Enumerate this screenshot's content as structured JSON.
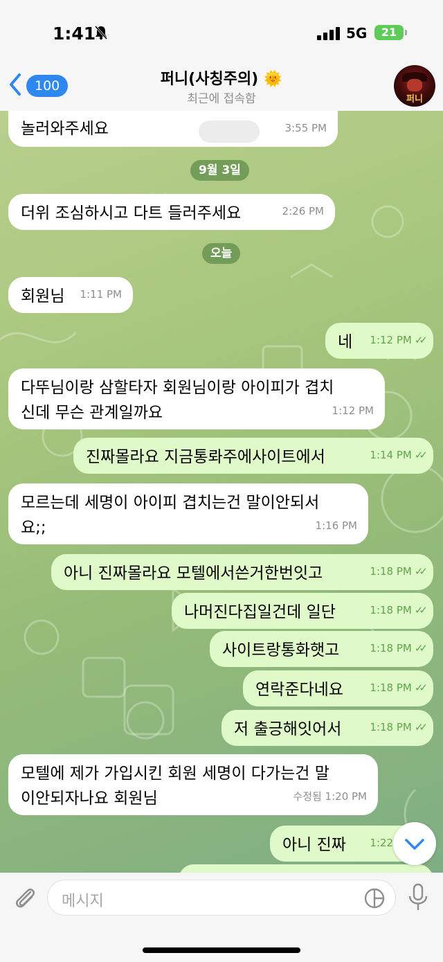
{
  "status_bar": {
    "time": "1:41",
    "network": "5G",
    "battery": "21"
  },
  "header": {
    "back_count": "100",
    "title": "퍼니(사칭주의) 🌞",
    "subtitle": "최근에 접속함",
    "avatar_text": "퍼니"
  },
  "messages": [
    {
      "dir": "in",
      "text": "놀러와주세요",
      "time": "3:55 PM"
    },
    {
      "type": "date",
      "text": "9월 3일"
    },
    {
      "dir": "in",
      "text": "더위 조심하시고 다트 들러주세요",
      "time": "2:26 PM"
    },
    {
      "type": "date",
      "text": "오늘"
    },
    {
      "dir": "in",
      "text": "회원님",
      "time": "1:11 PM"
    },
    {
      "dir": "out",
      "text": "네",
      "time": "1:12 PM"
    },
    {
      "dir": "in",
      "text": "다뚜님이랑 삼할타자 회원님이랑 아이피가 겹치신데 무슨 관계일까요",
      "line1": "다뚜님이랑 삼할타자 회원님이랑 아이피가 겹치",
      "line2": "신데 무슨 관계일까요",
      "time": "1:12 PM"
    },
    {
      "dir": "out",
      "text": "진짜몰라요 지금통롸주에사이트에서",
      "time": "1:14 PM"
    },
    {
      "dir": "in",
      "text": "모르는데 세명이 아이피 겹치는건 말이안되서요;;",
      "line1": "모르는데 세명이 아이피 겹치는건 말이안되서",
      "line2": "요;;",
      "time": "1:16 PM"
    },
    {
      "dir": "out",
      "text": "아니 진짜몰라요 모텔에서쓴거한번잇고",
      "time": "1:18 PM"
    },
    {
      "dir": "out",
      "text": "나머진다집일건데 일단",
      "time": "1:18 PM"
    },
    {
      "dir": "out",
      "text": "사이트랑통화햇고",
      "time": "1:18 PM"
    },
    {
      "dir": "out",
      "text": "연락준다네요",
      "time": "1:18 PM"
    },
    {
      "dir": "out",
      "text": "저 출긍해잇어서",
      "time": "1:18 PM"
    },
    {
      "dir": "in",
      "text": "모텔에 제가 가입시킨 회원 세명이 다가는건 말이안되자나요 회원님",
      "line1": "모텔에 제가 가입시킨 회원 세명이 다가는건 말",
      "line2": "이안되자나요 회원님",
      "time": "수정됨 1:20 PM"
    },
    {
      "dir": "out",
      "text": "아니 진짜",
      "time": "1:22 PM"
    }
  ],
  "input": {
    "placeholder": "메시지"
  },
  "colors": {
    "accent": "#2f88f0",
    "incoming_bubble": "#ffffff",
    "outgoing_bubble": "#e0f9c8",
    "read_check": "#5fa64a",
    "date_pill": "#5c8a48"
  },
  "icons": [
    "back-chevron-icon",
    "mute-bell-icon",
    "attach-icon",
    "sticker-icon",
    "microphone-icon",
    "scroll-down-icon",
    "read-receipt-icon"
  ]
}
